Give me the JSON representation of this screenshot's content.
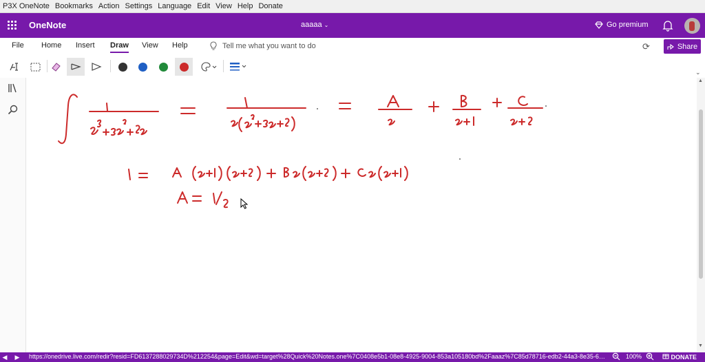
{
  "app_menu": [
    "P3X OneNote",
    "Bookmarks",
    "Action",
    "Settings",
    "Language",
    "Edit",
    "View",
    "Help",
    "Donate"
  ],
  "header": {
    "brand": "OneNote",
    "notebook": "aaaaa",
    "premium": "Go premium"
  },
  "ribbon": {
    "tabs": [
      "File",
      "Home",
      "Insert",
      "Draw",
      "View",
      "Help"
    ],
    "active_tab": "Draw",
    "tell_me": "Tell me what you want to do",
    "share": "Share"
  },
  "draw_tools": {
    "icons": [
      "type-select-icon",
      "lasso-select-icon",
      "eraser-icon",
      "pen-tool-icon",
      "highlighter-tool-icon"
    ],
    "pen_colors": [
      "#333333",
      "#1f5fc4",
      "#218a3a",
      "#cc2a2a"
    ],
    "selected_pen": "#cc2a2a"
  },
  "status_bar": {
    "url": "https://onedrive.live.com/redir?resid=FD6137288029734D%212254&page=Edit&wd=target%28Quick%20Notes.one%7C0408e5b1-08e8-4925-9004-853a105180bd%2Faaaz%7C85d78716-edb2-44a3-8e35-622f4...",
    "zoom": "100%",
    "donate": "DONATE"
  },
  "handwriting": {
    "line1": "∫ 1/(x^3+3x^2+2x) = 1/(x(x^2+3x+2)) = A/x + B/(x+1) + C/(x+2)",
    "line2": "1 = A(x+1)(x+2) + Bx(x+2) + Cx(x+1)",
    "line3": "A = 1/2"
  }
}
